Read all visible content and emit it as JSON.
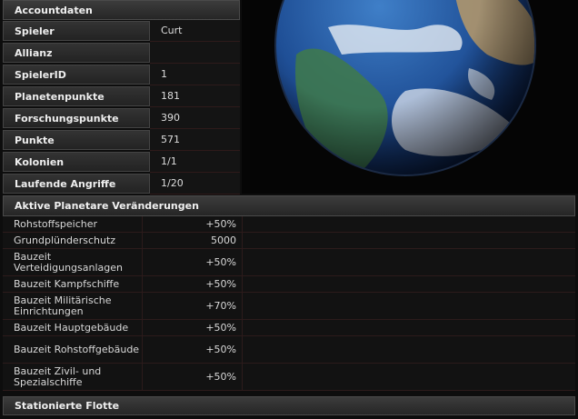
{
  "account": {
    "title": "Accountdaten",
    "rows": [
      {
        "label": "Spieler",
        "value": "Curt"
      },
      {
        "label": "Allianz",
        "value": ""
      },
      {
        "label": "SpielerID",
        "value": "1"
      },
      {
        "label": "Planetenpunkte",
        "value": "181"
      },
      {
        "label": "Forschungspunkte",
        "value": "390"
      },
      {
        "label": "Punkte",
        "value": "571"
      },
      {
        "label": "Kolonien",
        "value": "1/1"
      },
      {
        "label": "Laufende Angriffe",
        "value": "1/20"
      }
    ]
  },
  "changes": {
    "title": "Aktive Planetare Veränderungen",
    "rows": [
      {
        "name": "Rohstoffspeicher",
        "value": "+50%"
      },
      {
        "name": "Grundplünderschutz",
        "value": "5000"
      },
      {
        "name": "Bauzeit Verteidigungsanlagen",
        "value": "+50%"
      },
      {
        "name": "Bauzeit Kampfschiffe",
        "value": "+50%"
      },
      {
        "name": "Bauzeit Militärische Einrichtungen",
        "value": "+70%"
      },
      {
        "name": "Bauzeit Hauptgebäude",
        "value": "+50%"
      },
      {
        "name": "Bauzeit Rohstoffgebäude",
        "value": "+50%"
      },
      {
        "name": "Bauzeit Zivil- und Spezialschiffe",
        "value": "+50%"
      }
    ]
  },
  "fleet": {
    "title": "Stationierte Flotte"
  }
}
